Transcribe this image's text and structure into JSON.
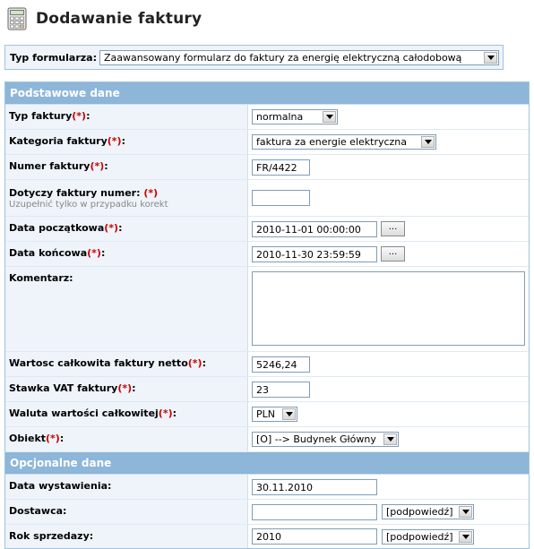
{
  "page": {
    "title": "Dodawanie faktury",
    "icon": "calculator-icon"
  },
  "form_type": {
    "label": "Typ formularza:",
    "value": "Zaawansowany formularz do faktury za energię elektryczną całodobową"
  },
  "required_marker": "(*)",
  "sections": {
    "basic": "Podstawowe dane",
    "optional": "Opcjonalne dane"
  },
  "fields": {
    "invoice_type": {
      "label": "Typ faktury",
      "value": "normalna"
    },
    "category": {
      "label": "Kategoria faktury",
      "value": "faktura za energie elektryczna"
    },
    "number": {
      "label": "Numer faktury",
      "value": "FR/4422"
    },
    "related": {
      "label": "Dotyczy faktury numer: ",
      "hint": "Uzupełnić tylko w przypadku korekt",
      "value": ""
    },
    "start_date": {
      "label": "Data początkowa",
      "value": "2010-11-01 00:00:00",
      "button": "..."
    },
    "end_date": {
      "label": "Data końcowa",
      "value": "2010-11-30 23:59:59",
      "button": "..."
    },
    "comment": {
      "label": "Komentarz:",
      "value": ""
    },
    "net_total": {
      "label": "Wartosc całkowita faktury netto",
      "value": "5246,24"
    },
    "vat": {
      "label": "Stawka VAT faktury",
      "value": "23"
    },
    "currency": {
      "label": "Waluta wartości całkowitej",
      "value": "PLN"
    },
    "object": {
      "label": "Obiekt",
      "value": "[O] --> Budynek Główny"
    },
    "issue_date": {
      "label": "Data wystawienia:",
      "value": "30.11.2010"
    },
    "supplier": {
      "label": "Dostawca:",
      "value": "",
      "hint_select": "[podpowiedź]"
    },
    "sale_year": {
      "label": "Rok sprzedazy:",
      "value": "2010",
      "hint_select": "[podpowiedź]"
    }
  },
  "colors": {
    "header_blue": "#8db6d8",
    "label_bg": "#eef4fa",
    "required_red": "#cc0000",
    "border": "#9fc2df"
  }
}
